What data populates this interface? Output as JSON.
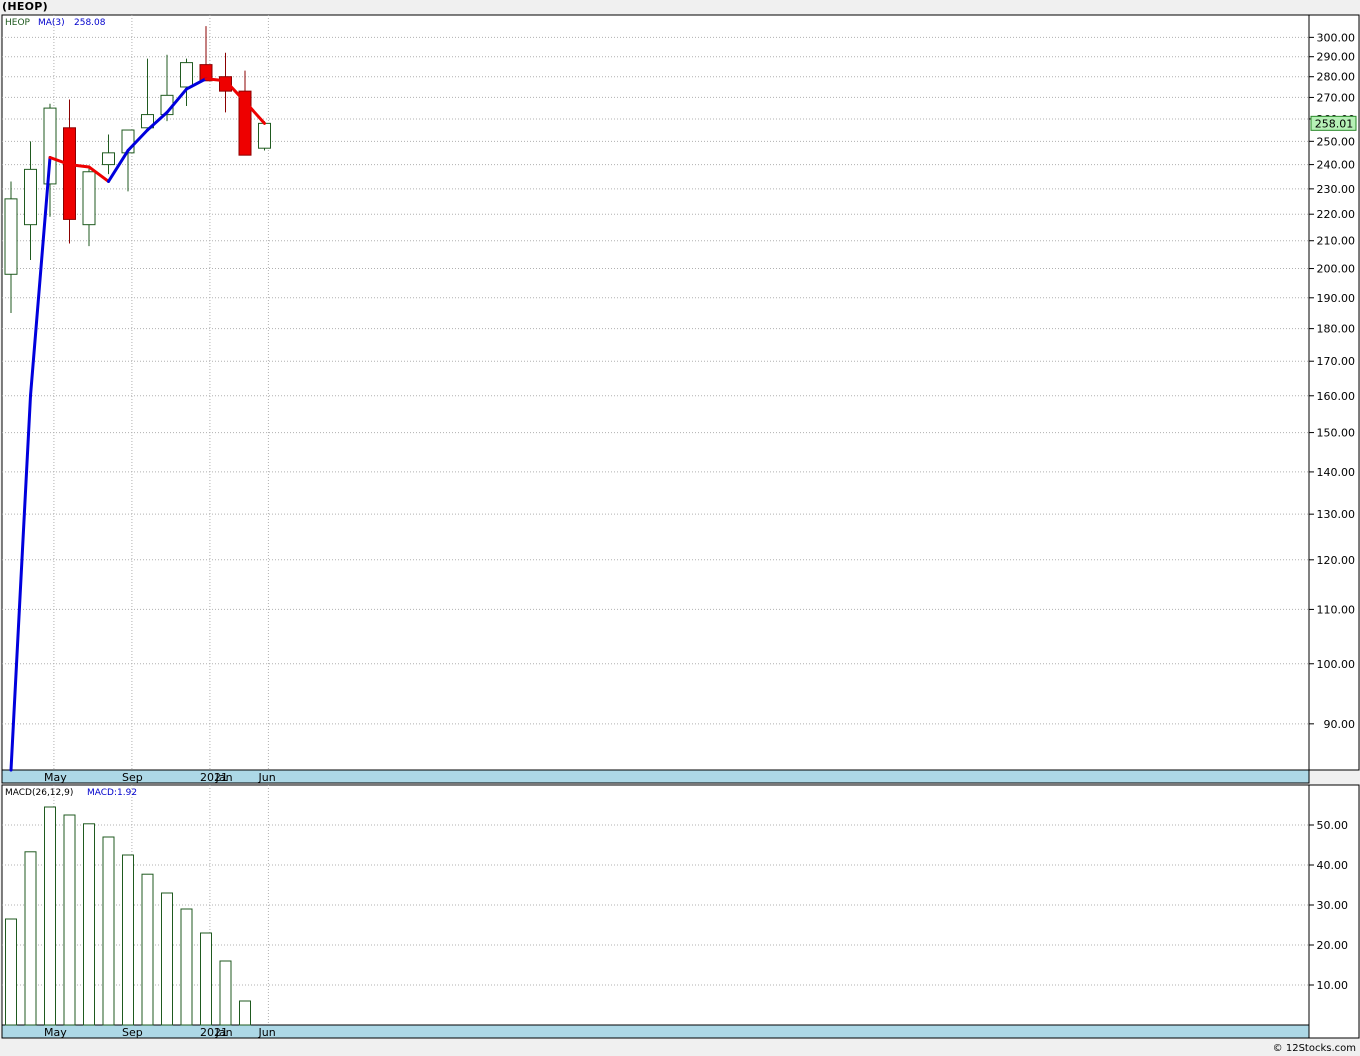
{
  "page_title": "(HEOP)",
  "copyright": "© 12Stocks.com",
  "colors": {
    "panel_bg": "#ffffff",
    "axis_bar": "#add8e6",
    "grid": "#b0b0b0",
    "candle_up_stroke": "#1f5a1f",
    "candle_down_fill": "#ee0000",
    "ma_up": "#0000dd",
    "ma_down": "#ee0000",
    "macd_bar": "#1f5a1f",
    "price_tag_bg": "#b6f0b6"
  },
  "chart_data": [
    {
      "type": "candlestick",
      "legend": {
        "symbol": "HEOP",
        "ma_label": "MA(3)",
        "ma_value": "258.08"
      },
      "last_price_tag": "258.01",
      "y_scale": "log",
      "ylim": [
        83,
        312
      ],
      "y_ticks": [
        90,
        100,
        110,
        120,
        130,
        140,
        150,
        160,
        170,
        180,
        190,
        200,
        210,
        220,
        230,
        240,
        250,
        260,
        270,
        280,
        290,
        300
      ],
      "x_ticks": [
        {
          "label": "May",
          "index": 2
        },
        {
          "label": "Sep",
          "index": 6
        },
        {
          "label": "2021",
          "index": 10
        },
        {
          "label": "Jan",
          "index": 10.8
        },
        {
          "label": "Jun",
          "index": 13
        }
      ],
      "x_gridlines": [
        2.2,
        6.2,
        10.2,
        13.2
      ],
      "candles": [
        {
          "o": 198,
          "h": 233,
          "l": 185,
          "c": 226
        },
        {
          "o": 216,
          "h": 250,
          "l": 203,
          "c": 238
        },
        {
          "o": 232,
          "h": 267,
          "l": 219,
          "c": 265
        },
        {
          "o": 256,
          "h": 269,
          "l": 209,
          "c": 218
        },
        {
          "o": 216,
          "h": 239,
          "l": 208,
          "c": 237
        },
        {
          "o": 240,
          "h": 253,
          "l": 236,
          "c": 245
        },
        {
          "o": 245,
          "h": 255,
          "l": 229,
          "c": 255
        },
        {
          "o": 256,
          "h": 289,
          "l": 255,
          "c": 262
        },
        {
          "o": 262,
          "h": 291,
          "l": 259,
          "c": 271
        },
        {
          "o": 275,
          "h": 289,
          "l": 266,
          "c": 287
        },
        {
          "o": 286,
          "h": 306,
          "l": 278,
          "c": 278
        },
        {
          "o": 280,
          "h": 292,
          "l": 263,
          "c": 273
        },
        {
          "o": 273,
          "h": 283,
          "l": 244,
          "c": 244
        },
        {
          "o": 247,
          "h": 259,
          "l": 246,
          "c": 258
        }
      ],
      "ma": [
        83,
        160,
        243,
        240,
        239,
        233,
        246,
        255,
        263,
        274,
        279,
        278,
        268,
        258
      ]
    },
    {
      "type": "bar",
      "legend": {
        "label": "MACD(26,12,9)",
        "value_label": "MACD:1.92"
      },
      "ylim": [
        0,
        60
      ],
      "y_ticks": [
        10,
        20,
        30,
        40,
        50
      ],
      "x_ticks": [
        {
          "label": "May",
          "index": 2
        },
        {
          "label": "Sep",
          "index": 6
        },
        {
          "label": "2021",
          "index": 10
        },
        {
          "label": "Jan",
          "index": 10.8
        },
        {
          "label": "Jun",
          "index": 13
        }
      ],
      "values": [
        26.5,
        43.3,
        54.5,
        52.5,
        50.3,
        47.0,
        42.5,
        37.7,
        33.0,
        29.0,
        23.0,
        16.0,
        6.0
      ]
    }
  ]
}
